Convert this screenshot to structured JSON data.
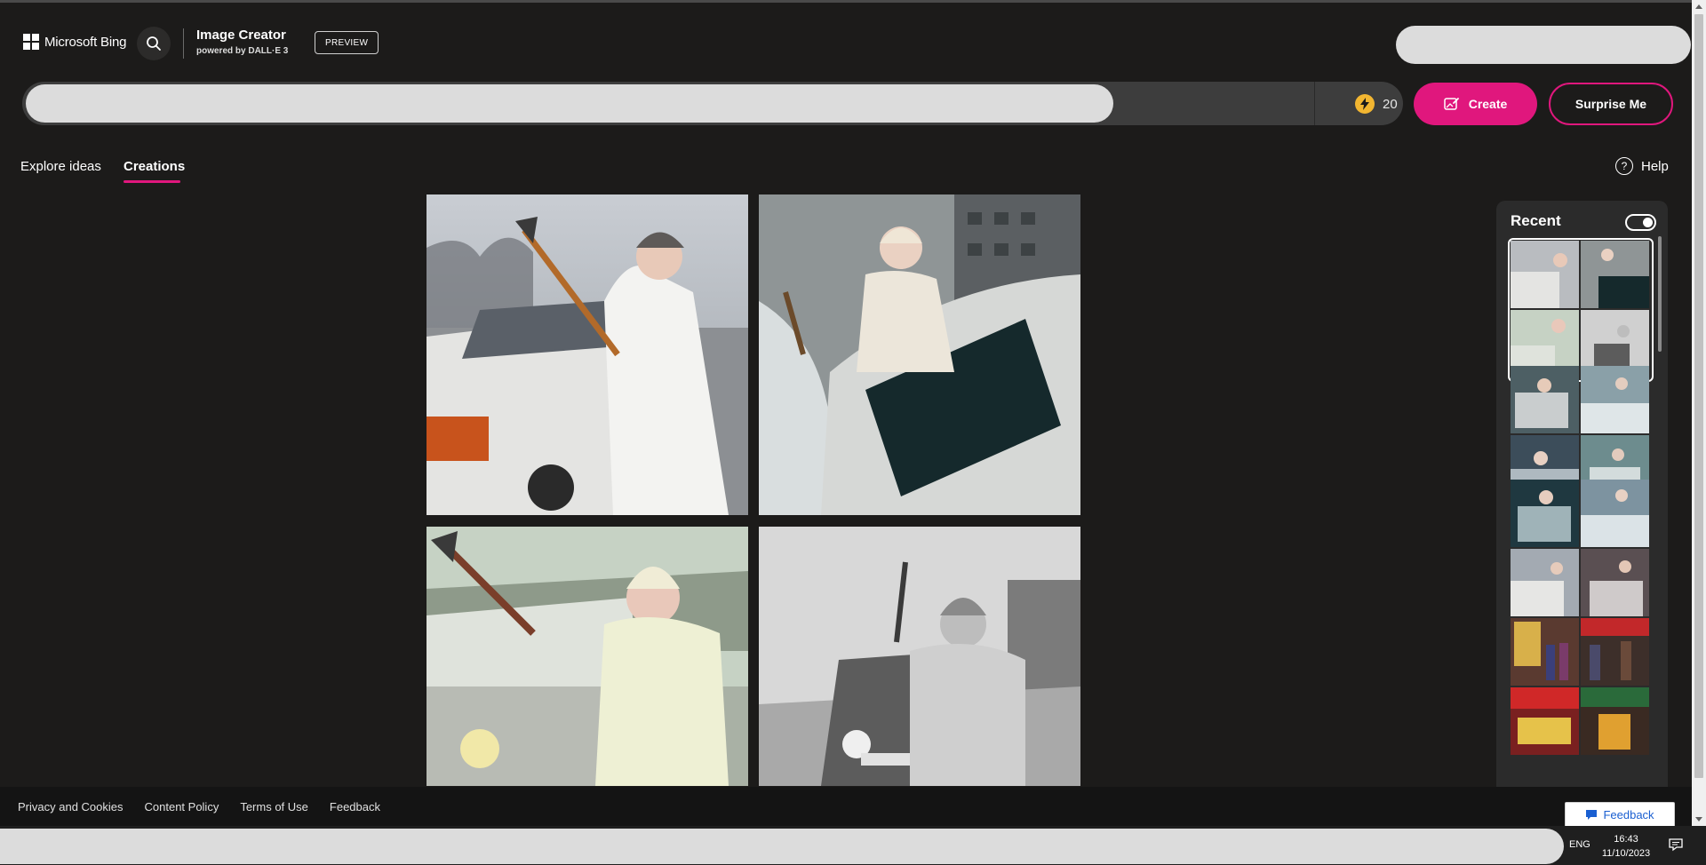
{
  "header": {
    "brand": "Microsoft Bing",
    "app_title": "Image Creator",
    "app_subtitle": "powered by DALL·E 3",
    "preview_badge": "PREVIEW"
  },
  "prompt": {
    "value": "",
    "boost_count": "20",
    "create_label": "Create",
    "surprise_label": "Surprise Me"
  },
  "tabs": {
    "explore": "Explore ideas",
    "creations": "Creations",
    "active": "Creations"
  },
  "help_label": "Help",
  "recent": {
    "title": "Recent",
    "toggle_on": true
  },
  "footer": {
    "links": [
      "Privacy and Cookies",
      "Content Policy",
      "Terms of Use",
      "Feedback"
    ],
    "feedback_button": "Feedback"
  },
  "taskbar": {
    "language": "ENG",
    "time": "16:43",
    "date": "11/10/2023"
  },
  "colors": {
    "accent": "#e0177d",
    "background": "#1c1b1a",
    "boost": "#f2b631"
  },
  "icons": [
    "windows-logo-icon",
    "search-icon",
    "lightning-icon",
    "create-image-icon",
    "help-icon",
    "feedback-icon",
    "notification-icon"
  ]
}
